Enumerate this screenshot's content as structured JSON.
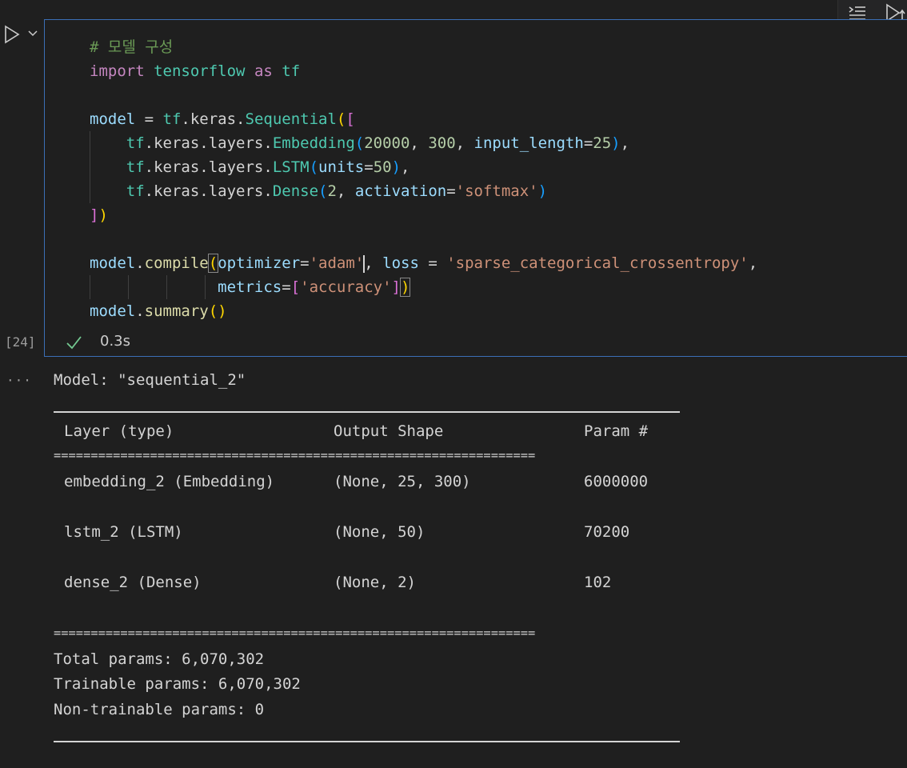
{
  "toolbar": {
    "outline_icon": "outline-list-icon",
    "run_above_icon": "run-above-icon"
  },
  "cell": {
    "run_icon": "play-icon",
    "exec_count": "[24]",
    "status_icon": "check-icon",
    "timing": "0.3s",
    "code": {
      "l1": "# 모델 구성",
      "l2_kw": "import",
      "l2_mod": "tensorflow",
      "l2_as": "as",
      "l2_alias": "tf",
      "l4_model": "model",
      "l4_eq": " = ",
      "l4_tf": "tf",
      "l4_keras": ".keras.",
      "l4_seq": "Sequential",
      "l4_p": "(",
      "l4_b": "[",
      "l5_tf": "tf",
      "l5_path": ".keras.layers.",
      "l5_fn": "Embedding",
      "l5_p": "(",
      "l5_n1": "20000",
      "l5_c1": ", ",
      "l5_n2": "300",
      "l5_c2": ", ",
      "l5_arg": "input_length",
      "l5_eq": "=",
      "l5_n3": "25",
      "l5_pc": ")",
      "l5_end": ",",
      "l6_tf": "tf",
      "l6_path": ".keras.layers.",
      "l6_fn": "LSTM",
      "l6_p": "(",
      "l6_arg": "units",
      "l6_eq": "=",
      "l6_n": "50",
      "l6_pc": ")",
      "l6_end": ",",
      "l7_tf": "tf",
      "l7_path": ".keras.layers.",
      "l7_fn": "Dense",
      "l7_p": "(",
      "l7_n": "2",
      "l7_c": ", ",
      "l7_arg": "activation",
      "l7_eq": "=",
      "l7_s": "'softmax'",
      "l7_pc": ")",
      "l8_b": "]",
      "l8_p": ")",
      "l10_model": "model",
      "l10_dot": ".",
      "l10_fn": "compile",
      "l10_p": "(",
      "l10_arg1": "optimizer",
      "l10_eq1": "=",
      "l10_s1": "'adam'",
      "l10_c": ", ",
      "l10_arg2": "loss",
      "l10_eq2": " = ",
      "l10_s2": "'sparse_categorical_crossentropy'",
      "l10_end": ",",
      "l11_arg": "metrics",
      "l11_eq": "=",
      "l11_b": "[",
      "l11_s": "'accuracy'",
      "l11_bc": "]",
      "l11_pc": ")",
      "l12_model": "model",
      "l12_dot": ".",
      "l12_fn": "summary",
      "l12_p": "()"
    }
  },
  "output": {
    "more_icon": "ellipsis-icon",
    "model_line": "Model: \"sequential_2\"",
    "headers": {
      "layer": "Layer (type)",
      "shape": "Output Shape",
      "params": "Param #"
    },
    "eq_rule": "=================================================================",
    "rows": [
      {
        "layer": "embedding_2 (Embedding)",
        "shape": "(None, 25, 300)",
        "params": "6000000"
      },
      {
        "layer": "lstm_2 (LSTM)",
        "shape": "(None, 50)",
        "params": "70200"
      },
      {
        "layer": "dense_2 (Dense)",
        "shape": "(None, 2)",
        "params": "102"
      }
    ],
    "total": "Total params: 6,070,302",
    "trainable": "Trainable params: 6,070,302",
    "non_trainable": "Non-trainable params: 0"
  }
}
